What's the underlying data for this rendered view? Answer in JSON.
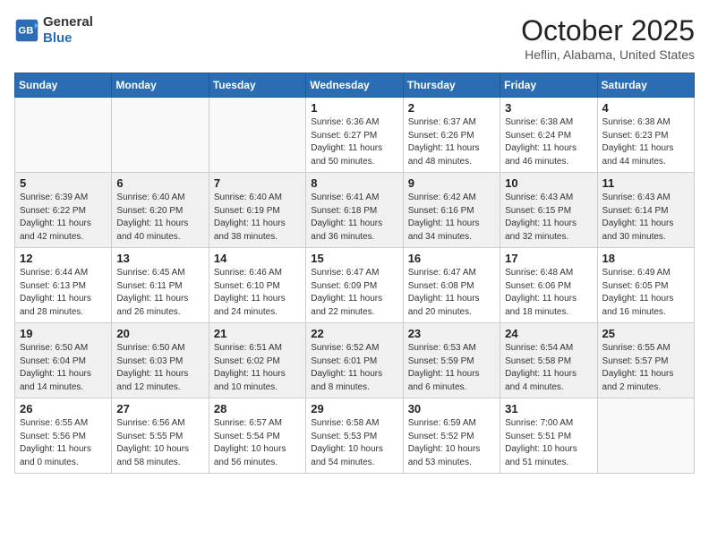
{
  "header": {
    "logo_line1": "General",
    "logo_line2": "Blue",
    "month": "October 2025",
    "location": "Heflin, Alabama, United States"
  },
  "days_of_week": [
    "Sunday",
    "Monday",
    "Tuesday",
    "Wednesday",
    "Thursday",
    "Friday",
    "Saturday"
  ],
  "weeks": [
    [
      {
        "day": "",
        "info": ""
      },
      {
        "day": "",
        "info": ""
      },
      {
        "day": "",
        "info": ""
      },
      {
        "day": "1",
        "info": "Sunrise: 6:36 AM\nSunset: 6:27 PM\nDaylight: 11 hours\nand 50 minutes."
      },
      {
        "day": "2",
        "info": "Sunrise: 6:37 AM\nSunset: 6:26 PM\nDaylight: 11 hours\nand 48 minutes."
      },
      {
        "day": "3",
        "info": "Sunrise: 6:38 AM\nSunset: 6:24 PM\nDaylight: 11 hours\nand 46 minutes."
      },
      {
        "day": "4",
        "info": "Sunrise: 6:38 AM\nSunset: 6:23 PM\nDaylight: 11 hours\nand 44 minutes."
      }
    ],
    [
      {
        "day": "5",
        "info": "Sunrise: 6:39 AM\nSunset: 6:22 PM\nDaylight: 11 hours\nand 42 minutes."
      },
      {
        "day": "6",
        "info": "Sunrise: 6:40 AM\nSunset: 6:20 PM\nDaylight: 11 hours\nand 40 minutes."
      },
      {
        "day": "7",
        "info": "Sunrise: 6:40 AM\nSunset: 6:19 PM\nDaylight: 11 hours\nand 38 minutes."
      },
      {
        "day": "8",
        "info": "Sunrise: 6:41 AM\nSunset: 6:18 PM\nDaylight: 11 hours\nand 36 minutes."
      },
      {
        "day": "9",
        "info": "Sunrise: 6:42 AM\nSunset: 6:16 PM\nDaylight: 11 hours\nand 34 minutes."
      },
      {
        "day": "10",
        "info": "Sunrise: 6:43 AM\nSunset: 6:15 PM\nDaylight: 11 hours\nand 32 minutes."
      },
      {
        "day": "11",
        "info": "Sunrise: 6:43 AM\nSunset: 6:14 PM\nDaylight: 11 hours\nand 30 minutes."
      }
    ],
    [
      {
        "day": "12",
        "info": "Sunrise: 6:44 AM\nSunset: 6:13 PM\nDaylight: 11 hours\nand 28 minutes."
      },
      {
        "day": "13",
        "info": "Sunrise: 6:45 AM\nSunset: 6:11 PM\nDaylight: 11 hours\nand 26 minutes."
      },
      {
        "day": "14",
        "info": "Sunrise: 6:46 AM\nSunset: 6:10 PM\nDaylight: 11 hours\nand 24 minutes."
      },
      {
        "day": "15",
        "info": "Sunrise: 6:47 AM\nSunset: 6:09 PM\nDaylight: 11 hours\nand 22 minutes."
      },
      {
        "day": "16",
        "info": "Sunrise: 6:47 AM\nSunset: 6:08 PM\nDaylight: 11 hours\nand 20 minutes."
      },
      {
        "day": "17",
        "info": "Sunrise: 6:48 AM\nSunset: 6:06 PM\nDaylight: 11 hours\nand 18 minutes."
      },
      {
        "day": "18",
        "info": "Sunrise: 6:49 AM\nSunset: 6:05 PM\nDaylight: 11 hours\nand 16 minutes."
      }
    ],
    [
      {
        "day": "19",
        "info": "Sunrise: 6:50 AM\nSunset: 6:04 PM\nDaylight: 11 hours\nand 14 minutes."
      },
      {
        "day": "20",
        "info": "Sunrise: 6:50 AM\nSunset: 6:03 PM\nDaylight: 11 hours\nand 12 minutes."
      },
      {
        "day": "21",
        "info": "Sunrise: 6:51 AM\nSunset: 6:02 PM\nDaylight: 11 hours\nand 10 minutes."
      },
      {
        "day": "22",
        "info": "Sunrise: 6:52 AM\nSunset: 6:01 PM\nDaylight: 11 hours\nand 8 minutes."
      },
      {
        "day": "23",
        "info": "Sunrise: 6:53 AM\nSunset: 5:59 PM\nDaylight: 11 hours\nand 6 minutes."
      },
      {
        "day": "24",
        "info": "Sunrise: 6:54 AM\nSunset: 5:58 PM\nDaylight: 11 hours\nand 4 minutes."
      },
      {
        "day": "25",
        "info": "Sunrise: 6:55 AM\nSunset: 5:57 PM\nDaylight: 11 hours\nand 2 minutes."
      }
    ],
    [
      {
        "day": "26",
        "info": "Sunrise: 6:55 AM\nSunset: 5:56 PM\nDaylight: 11 hours\nand 0 minutes."
      },
      {
        "day": "27",
        "info": "Sunrise: 6:56 AM\nSunset: 5:55 PM\nDaylight: 10 hours\nand 58 minutes."
      },
      {
        "day": "28",
        "info": "Sunrise: 6:57 AM\nSunset: 5:54 PM\nDaylight: 10 hours\nand 56 minutes."
      },
      {
        "day": "29",
        "info": "Sunrise: 6:58 AM\nSunset: 5:53 PM\nDaylight: 10 hours\nand 54 minutes."
      },
      {
        "day": "30",
        "info": "Sunrise: 6:59 AM\nSunset: 5:52 PM\nDaylight: 10 hours\nand 53 minutes."
      },
      {
        "day": "31",
        "info": "Sunrise: 7:00 AM\nSunset: 5:51 PM\nDaylight: 10 hours\nand 51 minutes."
      },
      {
        "day": "",
        "info": ""
      }
    ]
  ]
}
